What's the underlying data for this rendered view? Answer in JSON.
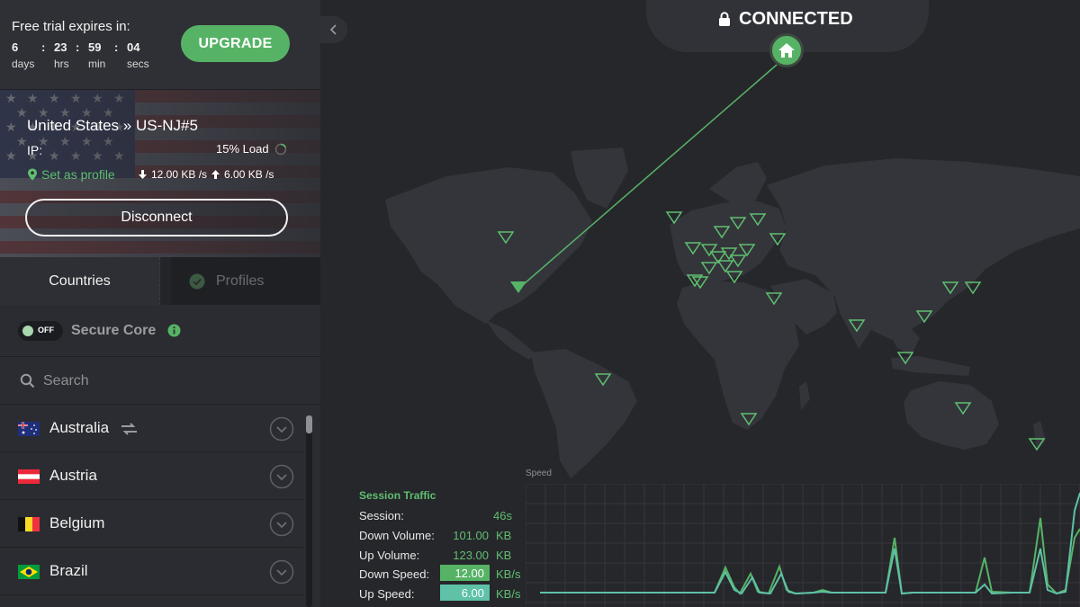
{
  "trial": {
    "title": "Free trial expires in:",
    "days": "6",
    "hrs": "23",
    "min": "59",
    "secs": "04",
    "days_label": "days",
    "hrs_label": "hrs",
    "min_label": "min",
    "secs_label": "secs",
    "upgrade_label": "UPGRADE"
  },
  "server": {
    "name": "United States » US-NJ#5",
    "ip_label": "IP:",
    "load": "15% Load",
    "set_profile": "Set as profile",
    "down_speed": "12.00 KB /s",
    "up_speed": "6.00 KB /s",
    "disconnect_label": "Disconnect"
  },
  "tabs": {
    "countries": "Countries",
    "profiles": "Profiles"
  },
  "secure_core": {
    "label": "Secure Core",
    "toggle": "OFF"
  },
  "search": {
    "placeholder": "Search"
  },
  "countries": [
    {
      "name": "Australia",
      "flag": "au",
      "p2p": true
    },
    {
      "name": "Austria",
      "flag": "at",
      "p2p": false
    },
    {
      "name": "Belgium",
      "flag": "be",
      "p2p": false
    },
    {
      "name": "Brazil",
      "flag": "br",
      "p2p": false
    }
  ],
  "status": {
    "label": "CONNECTED"
  },
  "traffic": {
    "title": "Session Traffic",
    "session_label": "Session:",
    "session_value": "46s",
    "down_volume_label": "Down Volume:",
    "down_volume_value": "101.00",
    "down_volume_unit": "KB",
    "up_volume_label": "Up Volume:",
    "up_volume_value": "123.00",
    "up_volume_unit": "KB",
    "down_speed_label": "Down Speed:",
    "down_speed_value": "12.00",
    "down_speed_unit": "KB/s",
    "up_speed_label": "Up Speed:",
    "up_speed_value": "6.00",
    "up_speed_unit": "KB/s",
    "chart_label": "Speed"
  },
  "colors": {
    "accent": "#56b366",
    "up_speed": "#5ec1a8",
    "background": "#26272b",
    "land": "#34353b"
  }
}
